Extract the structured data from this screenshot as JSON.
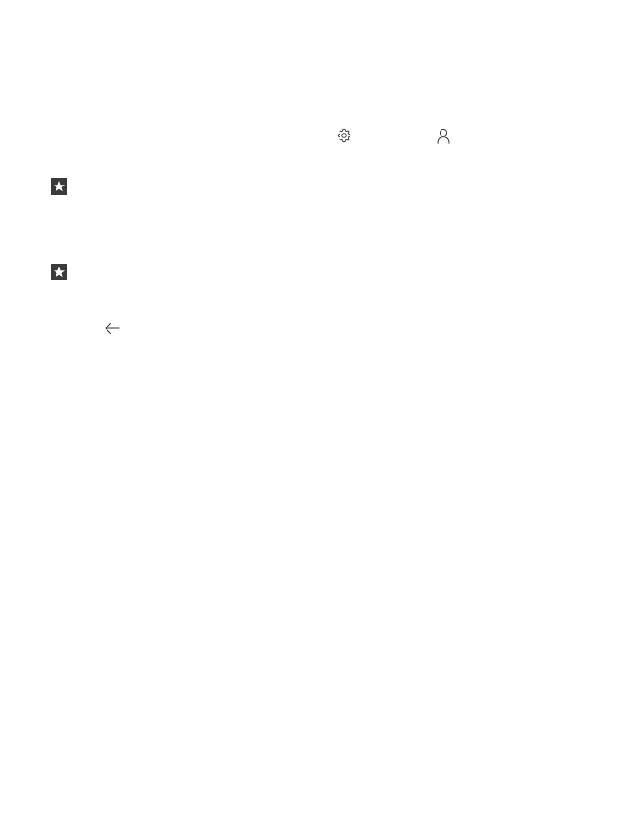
{
  "icons": {
    "settings": "gear-icon",
    "account": "person-icon",
    "tips": [
      "star-tip-icon",
      "star-tip-icon"
    ],
    "back": "back-arrow-icon"
  },
  "colors": {
    "background": "#ffffff",
    "icon_stroke": "#333333",
    "tip_badge": "#3a3a3a"
  }
}
